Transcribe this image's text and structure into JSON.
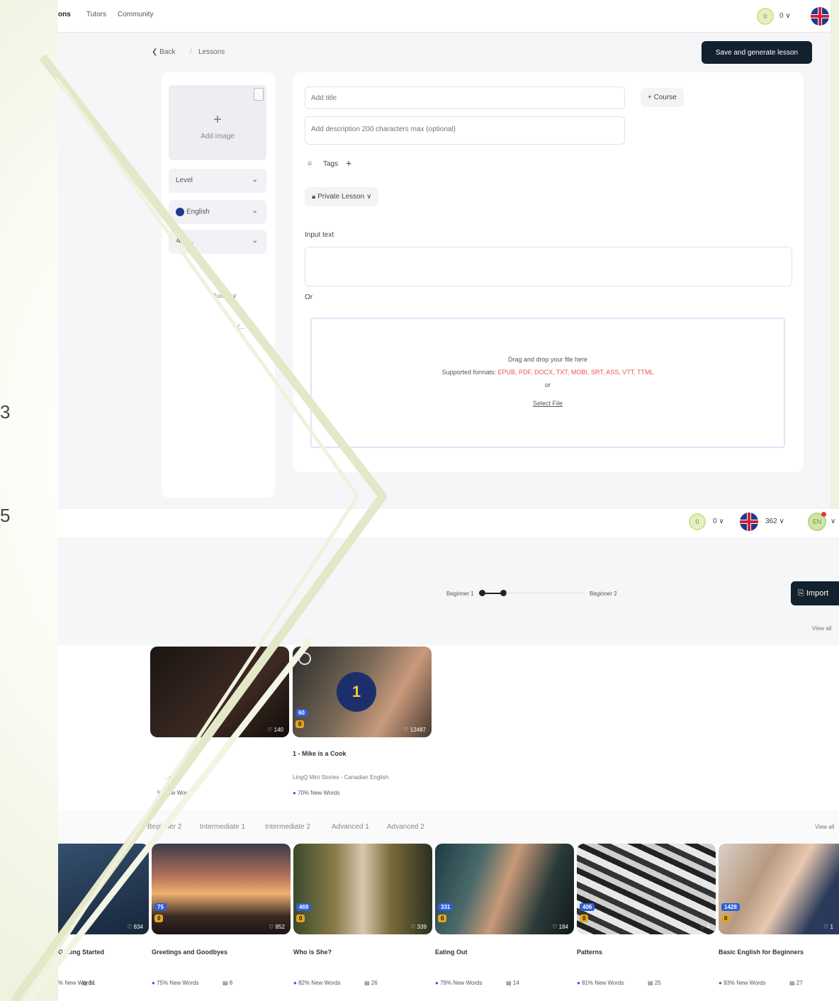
{
  "side_digits": [
    "3",
    "5"
  ],
  "top": {
    "nav": {
      "lessons": "ons",
      "tutors": "Tutors",
      "community": "Community",
      "coin_label": "0",
      "coin_count": "0 ∨"
    },
    "breadcrumb": {
      "back": "❮ Back",
      "sep": "/",
      "current": "Lessons"
    },
    "save_button": "Save and generate lesson",
    "add_image": "Add image",
    "selects": [
      {
        "label": "Level",
        "chevron": "⌄"
      },
      {
        "label": "English",
        "chevron": "⌄"
      },
      {
        "label": "Acc...",
        "chevron": "⌄"
      }
    ],
    "faint_labels": [
      "Audi... ∨",
      "V..."
    ],
    "title_placeholder": "Add title",
    "description_placeholder": "Add description 200 characters max (optional)",
    "course_button": "+ Course",
    "tags_label": "Tags",
    "tags_add": "+",
    "privacy": "Private Lesson ∨",
    "input_text_label": "Input text",
    "or_label": "Or",
    "dropzone": {
      "title": "Drag and drop your file here",
      "formats_prefix": "Supported formats:",
      "formats": "EPUB, PDF, DOCX, TXT, MOBI, SRT, ASS, VTT, TTML",
      "or": "or",
      "select_file": "Select File"
    }
  },
  "bottom": {
    "header": {
      "coin_label": "0",
      "coin_count": "0 ∨",
      "words_count": "362 ∨",
      "avatar_label": "EN",
      "avatar_chevron": "∨"
    },
    "slider": {
      "left": "Beginner 1",
      "right": "Beginner 2"
    },
    "import_button": "Import",
    "view_all_1": "View all",
    "view_all_2": "View all",
    "row1": [
      {
        "likes": "♡ 140",
        "meta": "...ckles",
        "newwords": "% New Words"
      },
      {
        "blue": "60",
        "gold": "0",
        "likes": "♡ 12487",
        "title": "1 - Mike is a Cook",
        "meta": "LingQ Mini Stories - Canadian English",
        "newwords": "70% New Words"
      }
    ],
    "level_tabs": [
      "Beginner 2",
      "Intermediate 1",
      "Intermediate 2",
      "Advanced 1",
      "Advanced 2"
    ],
    "row2": [
      {
        "likes": "♡ 834",
        "title": "Getting Started",
        "newwords": "% New Words",
        "lessons": "51"
      },
      {
        "blue": "75",
        "gold": "0",
        "likes": "♡ 852",
        "title": "Greetings and Goodbyes",
        "newwords": "75% New Words",
        "lessons": "8"
      },
      {
        "blue": "469",
        "gold": "0",
        "likes": "♡ 339",
        "title": "Who is She?",
        "newwords": "82% New Words",
        "lessons": "26"
      },
      {
        "blue": "331",
        "gold": "0",
        "likes": "♡ 184",
        "title": "Eating Out",
        "newwords": "79% New Words",
        "lessons": "14"
      },
      {
        "blue": "406",
        "gold": "0",
        "likes": "♡ 4",
        "title": "Patterns",
        "newwords": "81% New Words",
        "lessons": "25"
      },
      {
        "blue": "1428",
        "gold": "0",
        "likes": "♡ 1",
        "title": "Basic English for Beginners",
        "newwords": "93% New Words",
        "lessons": "27"
      }
    ]
  },
  "colors": {
    "background": "#eef2de",
    "dark_button": "#13202e",
    "formats_red": "#e85454",
    "badge_blue": "#2f5fd6",
    "badge_gold": "#e2a521",
    "stripe": "#e2e8c8"
  }
}
